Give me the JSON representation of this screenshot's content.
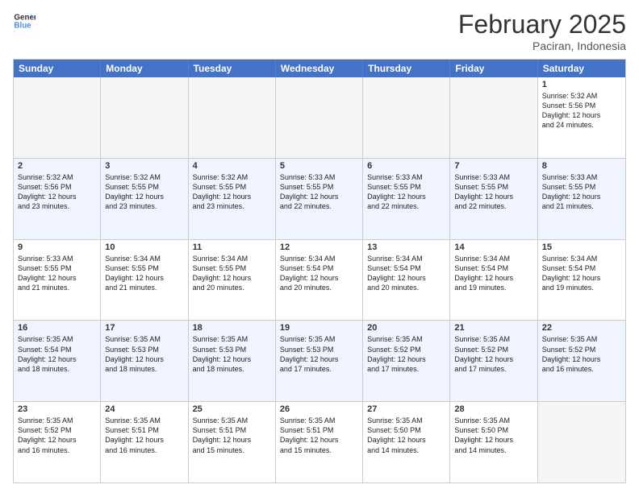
{
  "header": {
    "logo_line1": "General",
    "logo_line2": "Blue",
    "month_title": "February 2025",
    "location": "Paciran, Indonesia"
  },
  "days_of_week": [
    "Sunday",
    "Monday",
    "Tuesday",
    "Wednesday",
    "Thursday",
    "Friday",
    "Saturday"
  ],
  "weeks": [
    [
      {
        "day": "",
        "info": "",
        "empty": true
      },
      {
        "day": "",
        "info": "",
        "empty": true
      },
      {
        "day": "",
        "info": "",
        "empty": true
      },
      {
        "day": "",
        "info": "",
        "empty": true
      },
      {
        "day": "",
        "info": "",
        "empty": true
      },
      {
        "day": "",
        "info": "",
        "empty": true
      },
      {
        "day": "1",
        "info": "Sunrise: 5:32 AM\nSunset: 5:56 PM\nDaylight: 12 hours\nand 24 minutes.",
        "empty": false
      }
    ],
    [
      {
        "day": "2",
        "info": "Sunrise: 5:32 AM\nSunset: 5:56 PM\nDaylight: 12 hours\nand 23 minutes.",
        "empty": false
      },
      {
        "day": "3",
        "info": "Sunrise: 5:32 AM\nSunset: 5:55 PM\nDaylight: 12 hours\nand 23 minutes.",
        "empty": false
      },
      {
        "day": "4",
        "info": "Sunrise: 5:32 AM\nSunset: 5:55 PM\nDaylight: 12 hours\nand 23 minutes.",
        "empty": false
      },
      {
        "day": "5",
        "info": "Sunrise: 5:33 AM\nSunset: 5:55 PM\nDaylight: 12 hours\nand 22 minutes.",
        "empty": false
      },
      {
        "day": "6",
        "info": "Sunrise: 5:33 AM\nSunset: 5:55 PM\nDaylight: 12 hours\nand 22 minutes.",
        "empty": false
      },
      {
        "day": "7",
        "info": "Sunrise: 5:33 AM\nSunset: 5:55 PM\nDaylight: 12 hours\nand 22 minutes.",
        "empty": false
      },
      {
        "day": "8",
        "info": "Sunrise: 5:33 AM\nSunset: 5:55 PM\nDaylight: 12 hours\nand 21 minutes.",
        "empty": false
      }
    ],
    [
      {
        "day": "9",
        "info": "Sunrise: 5:33 AM\nSunset: 5:55 PM\nDaylight: 12 hours\nand 21 minutes.",
        "empty": false
      },
      {
        "day": "10",
        "info": "Sunrise: 5:34 AM\nSunset: 5:55 PM\nDaylight: 12 hours\nand 21 minutes.",
        "empty": false
      },
      {
        "day": "11",
        "info": "Sunrise: 5:34 AM\nSunset: 5:55 PM\nDaylight: 12 hours\nand 20 minutes.",
        "empty": false
      },
      {
        "day": "12",
        "info": "Sunrise: 5:34 AM\nSunset: 5:54 PM\nDaylight: 12 hours\nand 20 minutes.",
        "empty": false
      },
      {
        "day": "13",
        "info": "Sunrise: 5:34 AM\nSunset: 5:54 PM\nDaylight: 12 hours\nand 20 minutes.",
        "empty": false
      },
      {
        "day": "14",
        "info": "Sunrise: 5:34 AM\nSunset: 5:54 PM\nDaylight: 12 hours\nand 19 minutes.",
        "empty": false
      },
      {
        "day": "15",
        "info": "Sunrise: 5:34 AM\nSunset: 5:54 PM\nDaylight: 12 hours\nand 19 minutes.",
        "empty": false
      }
    ],
    [
      {
        "day": "16",
        "info": "Sunrise: 5:35 AM\nSunset: 5:54 PM\nDaylight: 12 hours\nand 18 minutes.",
        "empty": false
      },
      {
        "day": "17",
        "info": "Sunrise: 5:35 AM\nSunset: 5:53 PM\nDaylight: 12 hours\nand 18 minutes.",
        "empty": false
      },
      {
        "day": "18",
        "info": "Sunrise: 5:35 AM\nSunset: 5:53 PM\nDaylight: 12 hours\nand 18 minutes.",
        "empty": false
      },
      {
        "day": "19",
        "info": "Sunrise: 5:35 AM\nSunset: 5:53 PM\nDaylight: 12 hours\nand 17 minutes.",
        "empty": false
      },
      {
        "day": "20",
        "info": "Sunrise: 5:35 AM\nSunset: 5:52 PM\nDaylight: 12 hours\nand 17 minutes.",
        "empty": false
      },
      {
        "day": "21",
        "info": "Sunrise: 5:35 AM\nSunset: 5:52 PM\nDaylight: 12 hours\nand 17 minutes.",
        "empty": false
      },
      {
        "day": "22",
        "info": "Sunrise: 5:35 AM\nSunset: 5:52 PM\nDaylight: 12 hours\nand 16 minutes.",
        "empty": false
      }
    ],
    [
      {
        "day": "23",
        "info": "Sunrise: 5:35 AM\nSunset: 5:52 PM\nDaylight: 12 hours\nand 16 minutes.",
        "empty": false
      },
      {
        "day": "24",
        "info": "Sunrise: 5:35 AM\nSunset: 5:51 PM\nDaylight: 12 hours\nand 16 minutes.",
        "empty": false
      },
      {
        "day": "25",
        "info": "Sunrise: 5:35 AM\nSunset: 5:51 PM\nDaylight: 12 hours\nand 15 minutes.",
        "empty": false
      },
      {
        "day": "26",
        "info": "Sunrise: 5:35 AM\nSunset: 5:51 PM\nDaylight: 12 hours\nand 15 minutes.",
        "empty": false
      },
      {
        "day": "27",
        "info": "Sunrise: 5:35 AM\nSunset: 5:50 PM\nDaylight: 12 hours\nand 14 minutes.",
        "empty": false
      },
      {
        "day": "28",
        "info": "Sunrise: 5:35 AM\nSunset: 5:50 PM\nDaylight: 12 hours\nand 14 minutes.",
        "empty": false
      },
      {
        "day": "",
        "info": "",
        "empty": true
      }
    ]
  ]
}
